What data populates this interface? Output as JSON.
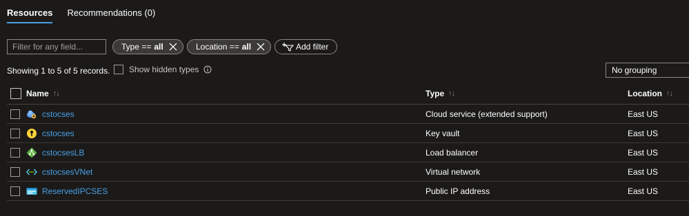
{
  "tabs": [
    {
      "label": "Resources",
      "active": true
    },
    {
      "label": "Recommendations (0)",
      "active": false
    }
  ],
  "filter": {
    "placeholder": "Filter for any field...",
    "pills": [
      {
        "field": "Type == ",
        "value": "all"
      },
      {
        "field": "Location == ",
        "value": "all"
      }
    ],
    "add_filter_label": "Add filter"
  },
  "records_text": "Showing 1 to 5 of 5 records.",
  "show_hidden_label": "Show hidden types",
  "grouping_value": "No grouping",
  "columns": {
    "name": "Name",
    "type": "Type",
    "location": "Location",
    "sort_glyph": "↑↓"
  },
  "rows": [
    {
      "name": "cstocses",
      "type": "Cloud service (extended support)",
      "location": "East US",
      "icon": "cloud-service-icon"
    },
    {
      "name": "cstocses",
      "type": "Key vault",
      "location": "East US",
      "icon": "key-vault-icon"
    },
    {
      "name": "cstocsesLB",
      "type": "Load balancer",
      "location": "East US",
      "icon": "load-balancer-icon"
    },
    {
      "name": "cstocsesVNet",
      "type": "Virtual network",
      "location": "East US",
      "icon": "virtual-network-icon"
    },
    {
      "name": "ReservedIPCSES",
      "type": "Public IP address",
      "location": "East US",
      "icon": "public-ip-icon"
    }
  ],
  "colors": {
    "background": "#1b1a19",
    "link": "#4aa0e6",
    "accent": "#4aa0e6"
  }
}
